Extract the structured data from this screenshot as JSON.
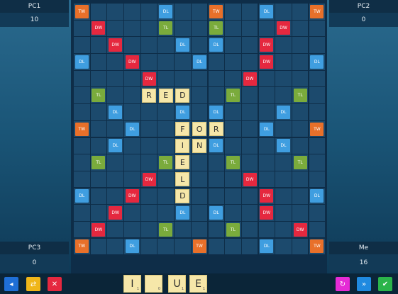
{
  "players": {
    "pc1": {
      "name": "PC1",
      "score": "10"
    },
    "pc2": {
      "name": "PC2",
      "score": "0"
    },
    "pc3": {
      "name": "PC3",
      "score": "0"
    },
    "me": {
      "name": "Me",
      "score": "16"
    }
  },
  "premium_colors": {
    "TW": "#e8702a",
    "DW": "#e5283f",
    "TL": "#7aab3c",
    "DL": "#3f9ee0"
  },
  "premium_rows": [
    "TW ..  ..  ..  ..  DL ..  ..  TW ..  ..  DL ..  ..  TW",
    ".. DW ..  ..  ..  TL ..  ..  TL ..  ..  ..  DW ..  ..",
    "..  ..  DW ..  ..  ..  DL ..  DL ..  ..  DW ..  ..  ..",
    "DL ..  ..  DW ..  ..  ..  DL ..  ..  ..  DW ..  ..  DL",
    "..  ..  ..  ..  DW ..  ..  ..  ..  ..  DW ..  ..  ..  ..",
    "..  TL ..  ..  ..  ..  ..  ..  ..  TL ..  ..  ..  TL ..",
    "..  ..  DL ..  ..  ..  DL ..  DL ..  ..  ..  DL ..  ..",
    "TW ..  ..  DL ..  ..  ..  ..  ..  ..  ..  DL ..  ..  TW",
    "..  ..  DL ..  ..  ..  ..  ..  DL ..  ..  ..  DL ..  ..",
    "..  TL ..  ..  ..  TL ..  ..  ..  TL ..  ..  ..  TL ..",
    "..  ..  ..  ..  DW ..  ..  ..  ..  ..  DW ..  ..  ..  ..",
    "DL ..  ..  DW ..  ..  ..  ..  ..  ..  ..  DW ..  ..  DL",
    "..  ..  DW ..  ..  ..  DL ..  DL ..  ..  DW ..  ..  ..",
    "..  DW ..  ..  ..  TL ..  ..  ..  TL ..  ..  ..  DW ..",
    "TW ..  ..  DL ..  ..  ..  TW ..  ..  ..  DL ..  ..  TW"
  ],
  "placed_tiles": [
    {
      "row": 5,
      "col": 4,
      "letter": "R"
    },
    {
      "row": 5,
      "col": 5,
      "letter": "E"
    },
    {
      "row": 5,
      "col": 6,
      "letter": "D"
    },
    {
      "row": 7,
      "col": 6,
      "letter": "F"
    },
    {
      "row": 7,
      "col": 7,
      "letter": "O"
    },
    {
      "row": 7,
      "col": 8,
      "letter": "R"
    },
    {
      "row": 8,
      "col": 6,
      "letter": "I"
    },
    {
      "row": 8,
      "col": 7,
      "letter": "N"
    },
    {
      "row": 9,
      "col": 6,
      "letter": "E"
    },
    {
      "row": 10,
      "col": 6,
      "letter": "L"
    },
    {
      "row": 11,
      "col": 6,
      "letter": "D"
    }
  ],
  "rack": [
    {
      "letter": "I",
      "points": "1"
    },
    {
      "letter": "",
      "points": "0"
    },
    {
      "letter": "U",
      "points": "1"
    },
    {
      "letter": "E",
      "points": "1"
    }
  ],
  "buttons": {
    "left": [
      {
        "name": "back-button",
        "icon": "back-arrow-icon",
        "color": "#1f6fd6",
        "glyph": "◂"
      },
      {
        "name": "swap-button",
        "icon": "swap-icon",
        "color": "#f0b619",
        "glyph": "⇄"
      },
      {
        "name": "shuffle-button",
        "icon": "shuffle-icon",
        "color": "#e5283f",
        "glyph": "✕"
      }
    ],
    "right": [
      {
        "name": "recall-button",
        "icon": "undo-icon",
        "color": "#e52bd6",
        "glyph": "↻"
      },
      {
        "name": "pass-button",
        "icon": "fast-forward-icon",
        "color": "#1f8ae0",
        "glyph": "»"
      },
      {
        "name": "submit-button",
        "icon": "check-icon",
        "color": "#2bb44a",
        "glyph": "✔"
      }
    ]
  }
}
